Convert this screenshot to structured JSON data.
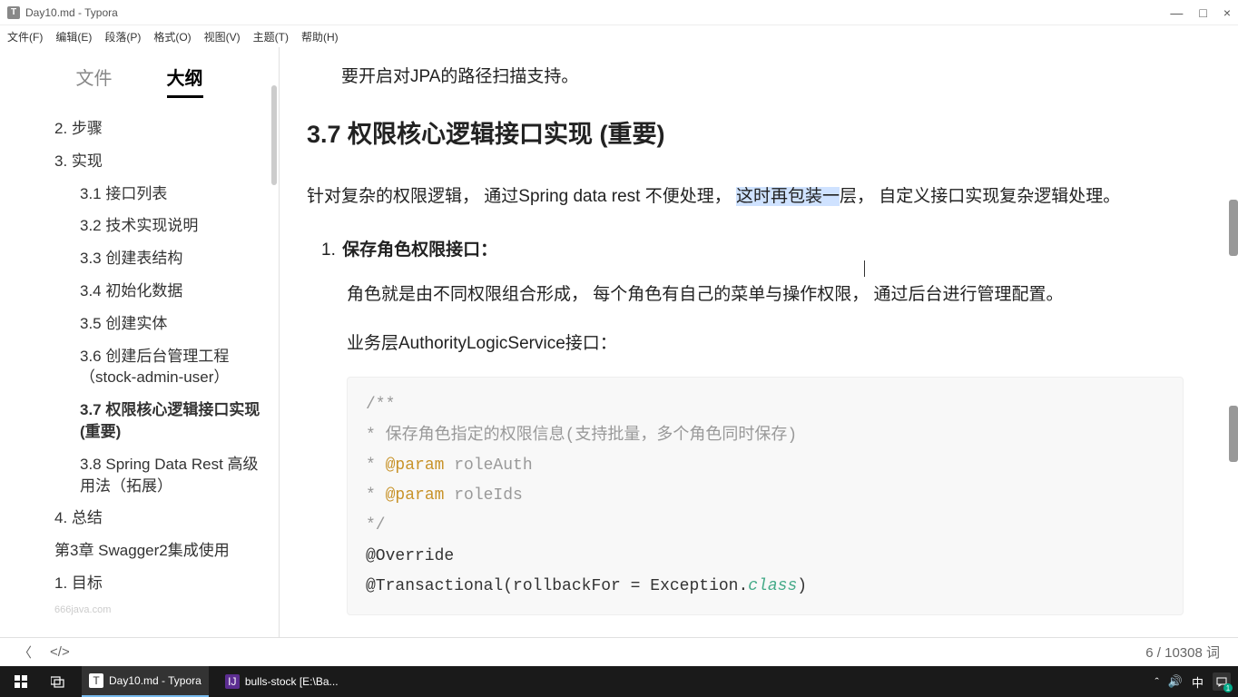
{
  "window": {
    "title": "Day10.md - Typora",
    "min": "—",
    "max": "□",
    "close": "×"
  },
  "menu": {
    "file": "文件(F)",
    "edit": "编辑(E)",
    "para": "段落(P)",
    "format": "格式(O)",
    "view": "视图(V)",
    "theme": "主题(T)",
    "help": "帮助(H)"
  },
  "sidebar": {
    "tab_file": "文件",
    "tab_outline": "大纲",
    "items": [
      {
        "lvl": "l1",
        "text": "2. 步骤",
        "active": false
      },
      {
        "lvl": "l1",
        "text": "3. 实现",
        "active": false
      },
      {
        "lvl": "l2",
        "text": "3.1 接口列表",
        "active": false
      },
      {
        "lvl": "l2",
        "text": "3.2 技术实现说明",
        "active": false
      },
      {
        "lvl": "l2",
        "text": "3.3 创建表结构",
        "active": false
      },
      {
        "lvl": "l2",
        "text": "3.4 初始化数据",
        "active": false
      },
      {
        "lvl": "l2",
        "text": "3.5 创建实体",
        "active": false
      },
      {
        "lvl": "l2",
        "text": "3.6 创建后台管理工程（stock-admin-user）",
        "active": false
      },
      {
        "lvl": "l2",
        "text": "3.7 权限核心逻辑接口实现 (重要)",
        "active": true
      },
      {
        "lvl": "l2",
        "text": "3.8 Spring Data Rest 高级用法（拓展）",
        "active": false
      },
      {
        "lvl": "l1",
        "text": "4. 总结",
        "active": false
      },
      {
        "lvl": "l1",
        "text": "第3章 Swagger2集成使用",
        "active": false
      },
      {
        "lvl": "l1",
        "text": "1. 目标",
        "active": false
      }
    ],
    "watermark": "666java.com"
  },
  "content": {
    "intro_tail": "要开启对JPA的路径扫描支持。",
    "heading": "3.7 权限核心逻辑接口实现 (重要)",
    "desc_pre": "针对复杂的权限逻辑，  通过Spring data rest 不便处理，  ",
    "desc_hl": "这时再包装一",
    "desc_post": "层，  自定义接口实现复杂逻辑处理。",
    "ol_num": "1.",
    "ol_title": "保存角色权限接口：",
    "sub1": "角色就是由不同权限组合形成，  每个角色有自己的菜单与操作权限，  通过后台进行管理配置。",
    "sub2": "业务层AuthorityLogicService接口：",
    "code": {
      "l1": "/**",
      "l2a": " *  ",
      "l2b": "保存角色指定的权限信息(支持批量，多个角色同时保存)",
      "l3a": " * ",
      "l3b": "@param",
      "l3c": " roleAuth",
      "l4a": " * ",
      "l4b": "@param",
      "l4c": " roleIds",
      "l5": " */",
      "l6": "@Override",
      "l7a": "@Transactional",
      "l7b": "(rollbackFor = Exception.",
      "l7c": "class",
      "l7d": ")"
    }
  },
  "status": {
    "back": "〈",
    "path": "</>",
    "words": "6 / 10308 词"
  },
  "taskbar": {
    "app1": "Day10.md - Typora",
    "app2": "bulls-stock [E:\\Ba...",
    "ime": "中",
    "notif_count": "1"
  }
}
